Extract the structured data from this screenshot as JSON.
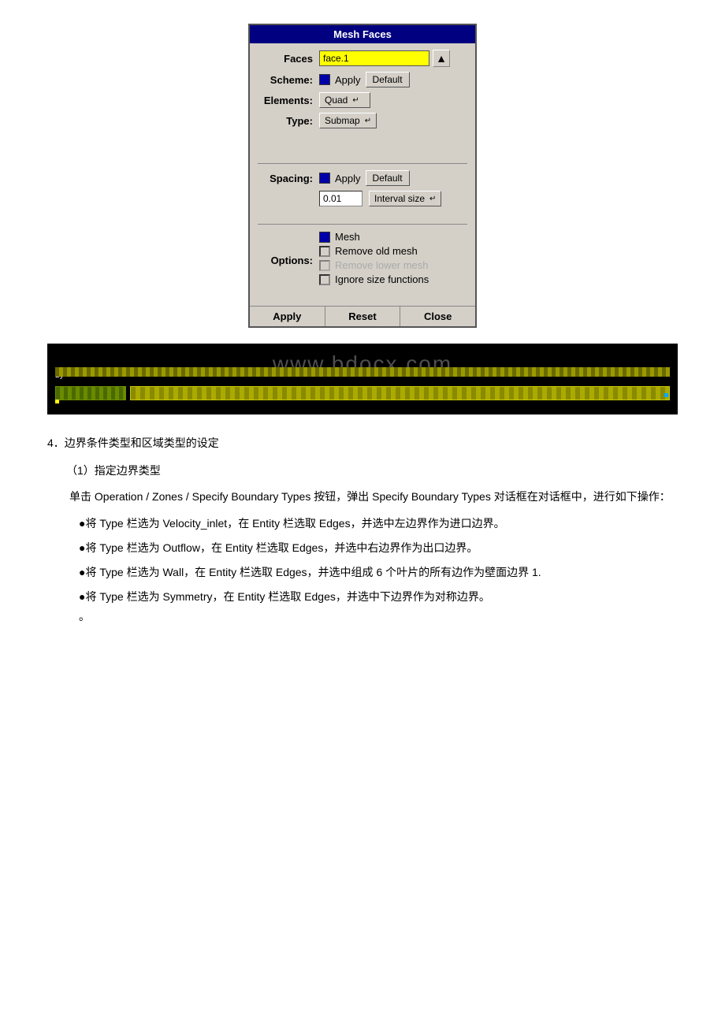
{
  "dialog": {
    "title": "Mesh Faces",
    "faces_label": "Faces",
    "faces_value": "face.1",
    "scheme_label": "Scheme:",
    "scheme_apply": "Apply",
    "scheme_default": "Default",
    "elements_label": "Elements:",
    "elements_value": "Quad",
    "type_label": "Type:",
    "type_value": "Submap",
    "spacing_label": "Spacing:",
    "spacing_apply": "Apply",
    "spacing_default": "Default",
    "spacing_input": "0.01",
    "spacing_type": "Interval size",
    "options_label": "Options:",
    "option_mesh": "Mesh",
    "option_remove_old": "Remove old mesh",
    "option_remove_lower": "Remove lower mesh",
    "option_ignore_size": "Ignore size functions",
    "btn_apply": "Apply",
    "btn_reset": "Reset",
    "btn_close": "Close"
  },
  "screenshot": {
    "watermark": "www.bdocx.com"
  },
  "content": {
    "section4": "4．边界条件类型和区域类型的设定",
    "sub1": "（1）指定边界类型",
    "para1": "单击 Operation / Zones / Specify Boundary Types 按钮，弹出 Specify Boundary Types 对话框在对话框中，进行如下操作：",
    "bullet1": "●将 Type 栏选为 Velocity_inlet，在 Entity 栏选取 Edges，并选中左边界作为进口边界。",
    "bullet2": "●将 Type 栏选为 Outflow，在 Entity 栏选取 Edges，并选中右边界作为出口边界。",
    "bullet3": "●将 Type 栏选为 Wall，在 Entity 栏选取 Edges，并选中组成 6 个叶片的所有边作为壁面边界 1.",
    "bullet4": "●将 Type 栏选为 Symmetry，在 Entity 栏选取 Edges，并选中下边界作为对称边界。"
  }
}
